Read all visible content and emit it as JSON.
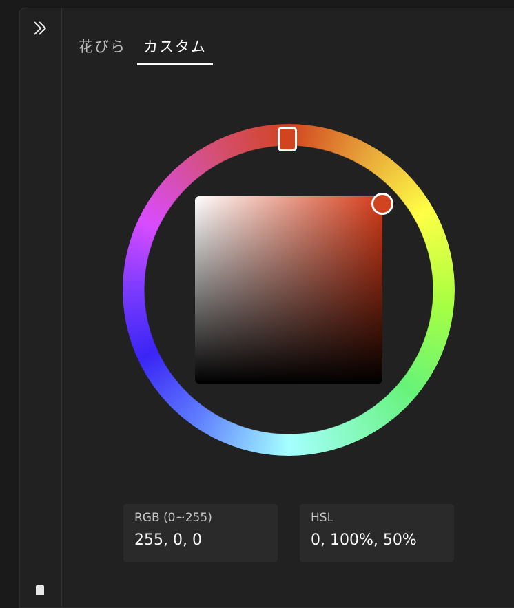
{
  "tabs": [
    {
      "label": "花びら",
      "active": false
    },
    {
      "label": "カスタム",
      "active": true
    }
  ],
  "sidebar": {
    "collapse_icon": "double-chevron-right-icon",
    "bottom_icon": "bookmark-icon"
  },
  "picker": {
    "hue_degrees": 0,
    "saturation": 1.0,
    "value": 1.0,
    "selected_color": "#d14420"
  },
  "values": {
    "rgb": {
      "label": "RGB (0~255)",
      "value": "255, 0, 0"
    },
    "hsl": {
      "label": "HSL",
      "value": "0, 100%, 50%"
    }
  }
}
